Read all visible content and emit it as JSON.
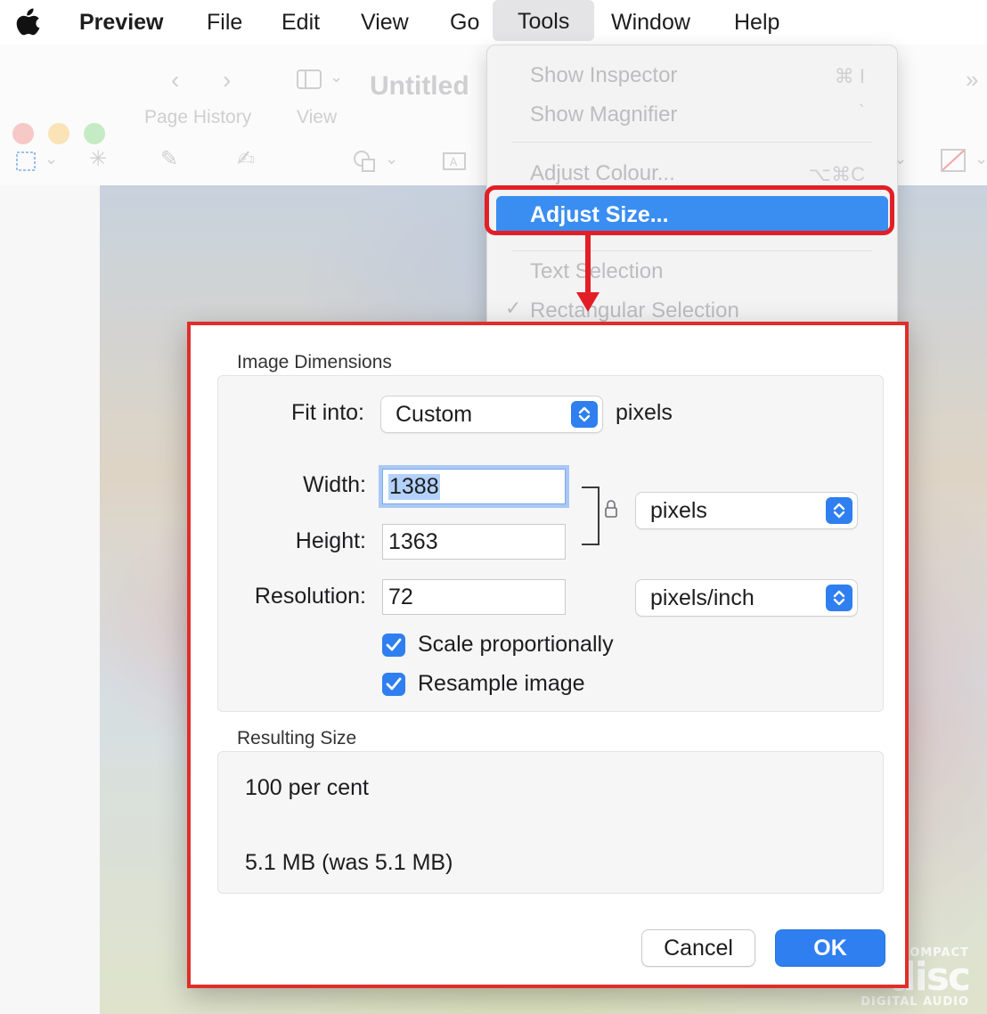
{
  "menubar": {
    "app": "Preview",
    "items": [
      "File",
      "Edit",
      "View",
      "Go",
      "Tools",
      "Window",
      "Help"
    ],
    "active": "Tools"
  },
  "window": {
    "title": "Untitled",
    "toolbar": {
      "page_history_label": "Page History",
      "view_label": "View"
    }
  },
  "tools_menu": {
    "items": [
      {
        "label": "Show Inspector",
        "shortcut": "⌘ I"
      },
      {
        "label": "Show Magnifier",
        "shortcut": "`"
      },
      {
        "label": "Adjust Colour...",
        "shortcut": "⌥⌘C"
      },
      {
        "label": "Adjust Size..."
      },
      {
        "label": "Text Selection"
      },
      {
        "label": "Rectangular Selection",
        "checkmark": "✓"
      }
    ]
  },
  "dialog": {
    "image_dimensions_title": "Image Dimensions",
    "fit_into_label": "Fit into:",
    "fit_into_value": "Custom",
    "fit_into_unit": "pixels",
    "width_label": "Width:",
    "width_value": "1388",
    "height_label": "Height:",
    "height_value": "1363",
    "size_unit": "pixels",
    "resolution_label": "Resolution:",
    "resolution_value": "72",
    "resolution_unit": "pixels/inch",
    "scale_proportionally_label": "Scale proportionally",
    "resample_image_label": "Resample image",
    "resulting_size_title": "Resulting Size",
    "result_percent": "100 per cent",
    "result_size": "5.1 MB (was 5.1 MB)",
    "cancel_label": "Cancel",
    "ok_label": "OK"
  },
  "artwork": {
    "logo_top": "COMPACT",
    "logo_mid": "disc",
    "logo_bottom": "DIGITAL AUDIO"
  },
  "colors": {
    "accent": "#2f7ff0",
    "annotation_red": "#e21f26"
  }
}
